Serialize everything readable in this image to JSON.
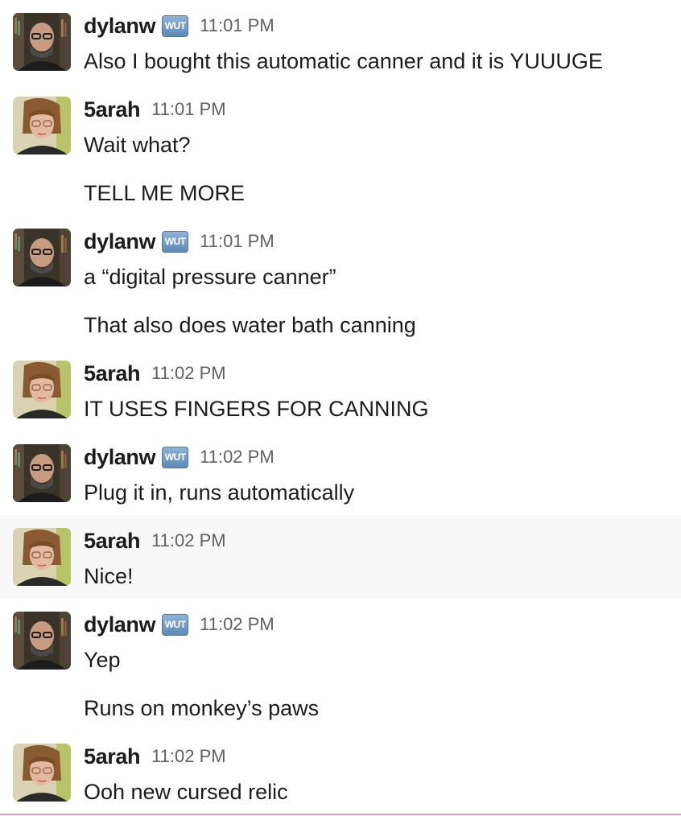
{
  "users": {
    "dylanw": {
      "name": "dylanw",
      "badge": "WUT"
    },
    "sarah": {
      "name": "5arah"
    }
  },
  "messages": [
    {
      "user": "dylanw",
      "time": "11:01 PM",
      "lines": [
        "Also I bought this automatic canner and it is YUUUGE"
      ]
    },
    {
      "user": "5arah",
      "time": "11:01 PM",
      "lines": [
        "Wait what?",
        "TELL ME MORE"
      ]
    },
    {
      "user": "dylanw",
      "time": "11:01 PM",
      "lines": [
        "a “digital pressure canner”",
        "That also does water bath canning"
      ]
    },
    {
      "user": "5arah",
      "time": "11:02 PM",
      "lines": [
        "IT USES FINGERS FOR CANNING"
      ]
    },
    {
      "user": "dylanw",
      "time": "11:02 PM",
      "lines": [
        "Plug it in, runs automatically"
      ]
    },
    {
      "user": "5arah",
      "time": "11:02 PM",
      "lines": [
        "Nice!"
      ]
    },
    {
      "user": "dylanw",
      "time": "11:02 PM",
      "lines": [
        "Yep",
        "Runs on monkey’s paws"
      ]
    },
    {
      "user": "5arah",
      "time": "11:02 PM",
      "lines": [
        "Ooh new cursed relic"
      ]
    }
  ],
  "colors": {
    "highlight_row": "#f8f8f8",
    "badge": "#6f97c4",
    "new_divider": "#e8a0b4"
  }
}
